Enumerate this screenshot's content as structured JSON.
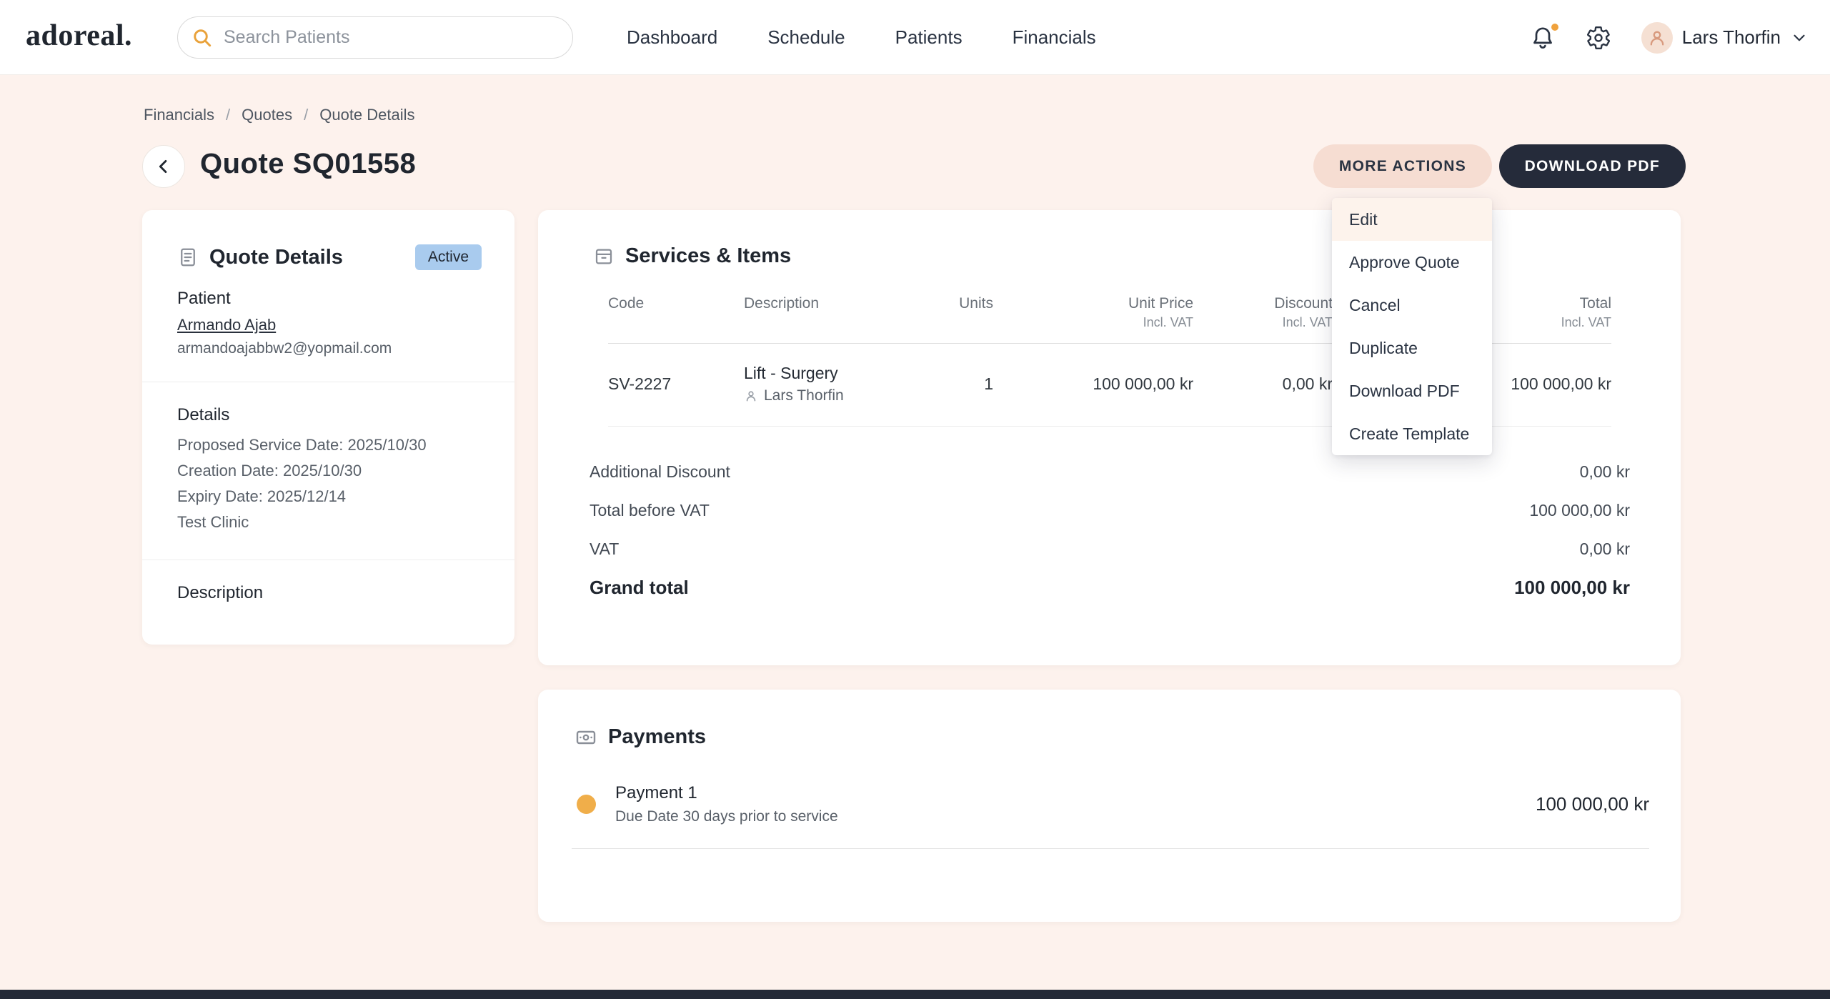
{
  "colors": {
    "background": "#fdf2ed",
    "accent_orange": "#e9a23b",
    "dark_navy": "#252b3a",
    "badge_blue": "#a9cbee",
    "more_actions_bg": "#f6ddd2",
    "payment_dot": "#f0ae4a"
  },
  "topbar": {
    "logo": "adoreal.",
    "search_placeholder": "Search Patients",
    "nav": [
      {
        "label": "Dashboard"
      },
      {
        "label": "Schedule"
      },
      {
        "label": "Patients"
      },
      {
        "label": "Financials"
      }
    ],
    "user_name": "Lars Thorfin"
  },
  "breadcrumb": {
    "separator": "/",
    "items": [
      "Financials",
      "Quotes",
      "Quote Details"
    ]
  },
  "page": {
    "title": "Quote SQ01558",
    "more_actions_label": "MORE ACTIONS",
    "download_pdf_label": "DOWNLOAD PDF"
  },
  "more_actions_menu": {
    "items": [
      "Edit",
      "Approve Quote",
      "Cancel",
      "Duplicate",
      "Download PDF",
      "Create Template"
    ]
  },
  "quote_details": {
    "title": "Quote Details",
    "status": "Active",
    "patient_label": "Patient",
    "patient_name": "Armando Ajab",
    "patient_email": "armandoajabbw2@yopmail.com",
    "details_label": "Details",
    "details_lines": [
      "Proposed Service Date: 2025/10/30",
      "Creation Date: 2025/10/30",
      "Expiry Date: 2025/12/14",
      "Test Clinic"
    ],
    "description_label": "Description"
  },
  "services": {
    "title": "Services & Items",
    "columns": [
      {
        "label": "Code",
        "sub": ""
      },
      {
        "label": "Description",
        "sub": ""
      },
      {
        "label": "Units",
        "sub": ""
      },
      {
        "label": "Unit Price",
        "sub": "Incl. VAT"
      },
      {
        "label": "Discount",
        "sub": "Incl. VAT"
      },
      {
        "label": "Total",
        "sub": "Incl. VAT"
      }
    ],
    "rows": [
      {
        "code": "SV-2227",
        "description": "Lift - Surgery",
        "provider": "Lars Thorfin",
        "units": "1",
        "unit_price": "100 000,00 kr",
        "discount": "0,00 kr",
        "total": "100 000,00 kr"
      }
    ],
    "summary": [
      {
        "label": "Additional Discount",
        "value": "0,00 kr"
      },
      {
        "label": "Total before VAT",
        "value": "100 000,00 kr"
      },
      {
        "label": "VAT",
        "value": "0,00 kr"
      }
    ],
    "grand_total_label": "Grand total",
    "grand_total_value": "100 000,00 kr"
  },
  "payments": {
    "title": "Payments",
    "items": [
      {
        "name": "Payment 1",
        "due": "Due Date 30 days prior to service",
        "amount": "100 000,00 kr"
      }
    ]
  }
}
